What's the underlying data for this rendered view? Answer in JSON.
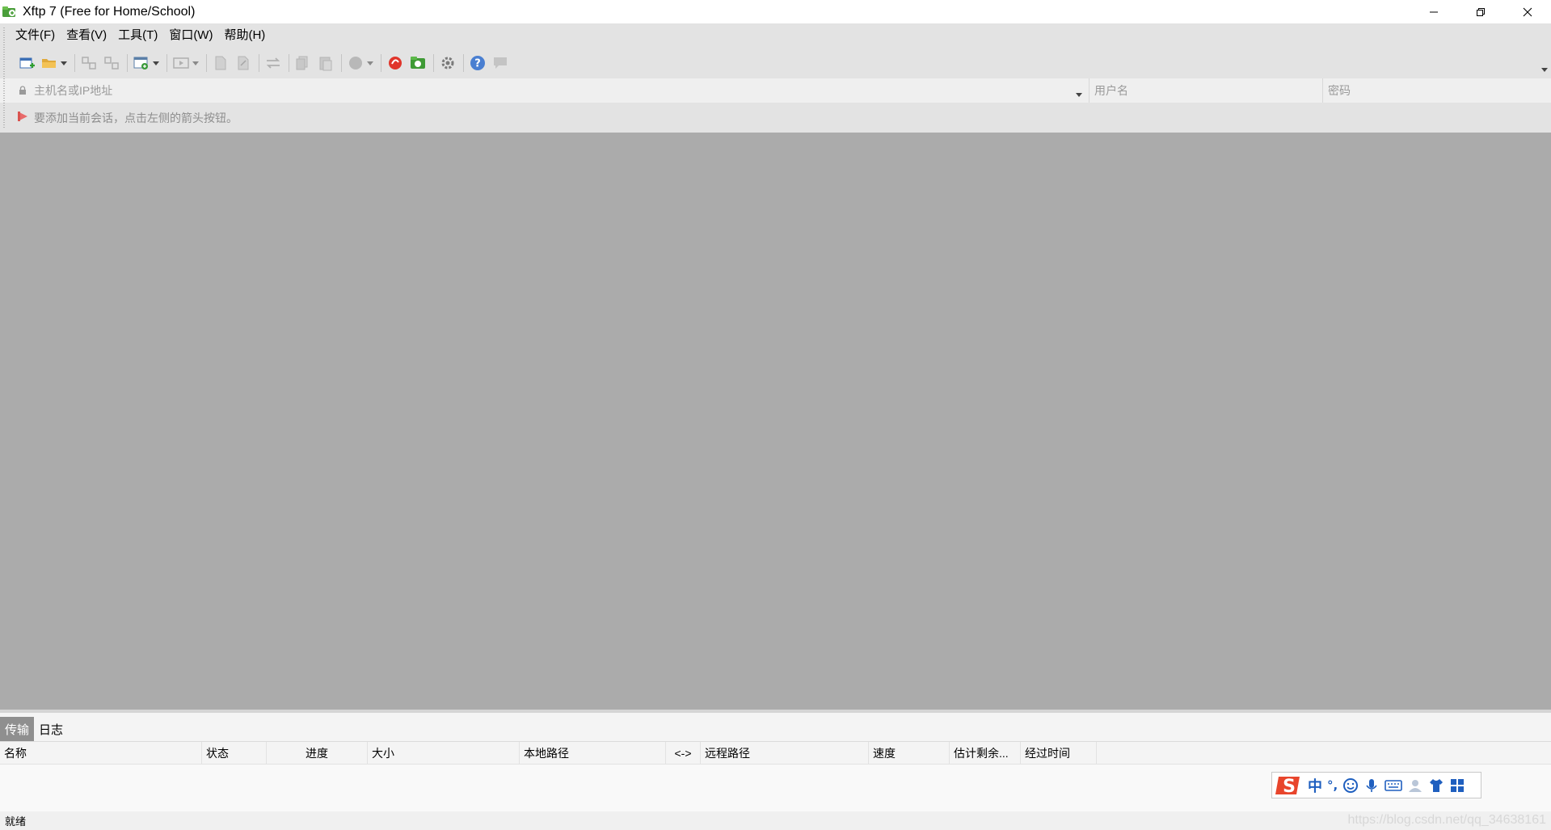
{
  "window": {
    "title": "Xftp 7 (Free for Home/School)"
  },
  "menu": {
    "items": [
      "文件(F)",
      "查看(V)",
      "工具(T)",
      "窗口(W)",
      "帮助(H)"
    ]
  },
  "toolbar": {
    "icons": [
      "new-session-icon",
      "open-folder-icon",
      "connect-icon",
      "disconnect-icon",
      "session-manager-icon",
      "terminal-icon",
      "new-file-icon",
      "edit-file-icon",
      "transfer-icon",
      "copy-icon",
      "paste-icon",
      "status-circle-icon",
      "xshell-icon",
      "xftp-icon",
      "settings-icon",
      "help-icon",
      "feedback-icon"
    ]
  },
  "address_bar": {
    "host_placeholder": "主机名或IP地址",
    "username_placeholder": "用户名",
    "password_placeholder": "密码"
  },
  "session_hint": {
    "text": "要添加当前会话，点击左侧的箭头按钮。"
  },
  "bottom_panel": {
    "tabs": [
      {
        "label": "传输",
        "active": true
      },
      {
        "label": "日志",
        "active": false
      }
    ],
    "columns": [
      "名称",
      "状态",
      "进度",
      "大小",
      "本地路径",
      "<->",
      "远程路径",
      "速度",
      "估计剩余...",
      "经过时间"
    ]
  },
  "ime": {
    "logo": "S",
    "mode": "中",
    "punct": "°,"
  },
  "status_bar": {
    "text": "就绪",
    "watermark": "https://blog.csdn.net/qq_34638161"
  },
  "colors": {
    "workspace": "#ababab",
    "toolbar_bg": "#e3e3e3",
    "active_tab": "#8f8f8f",
    "ime_accent": "#1f5fbf",
    "ime_logo": "#e8452c"
  }
}
